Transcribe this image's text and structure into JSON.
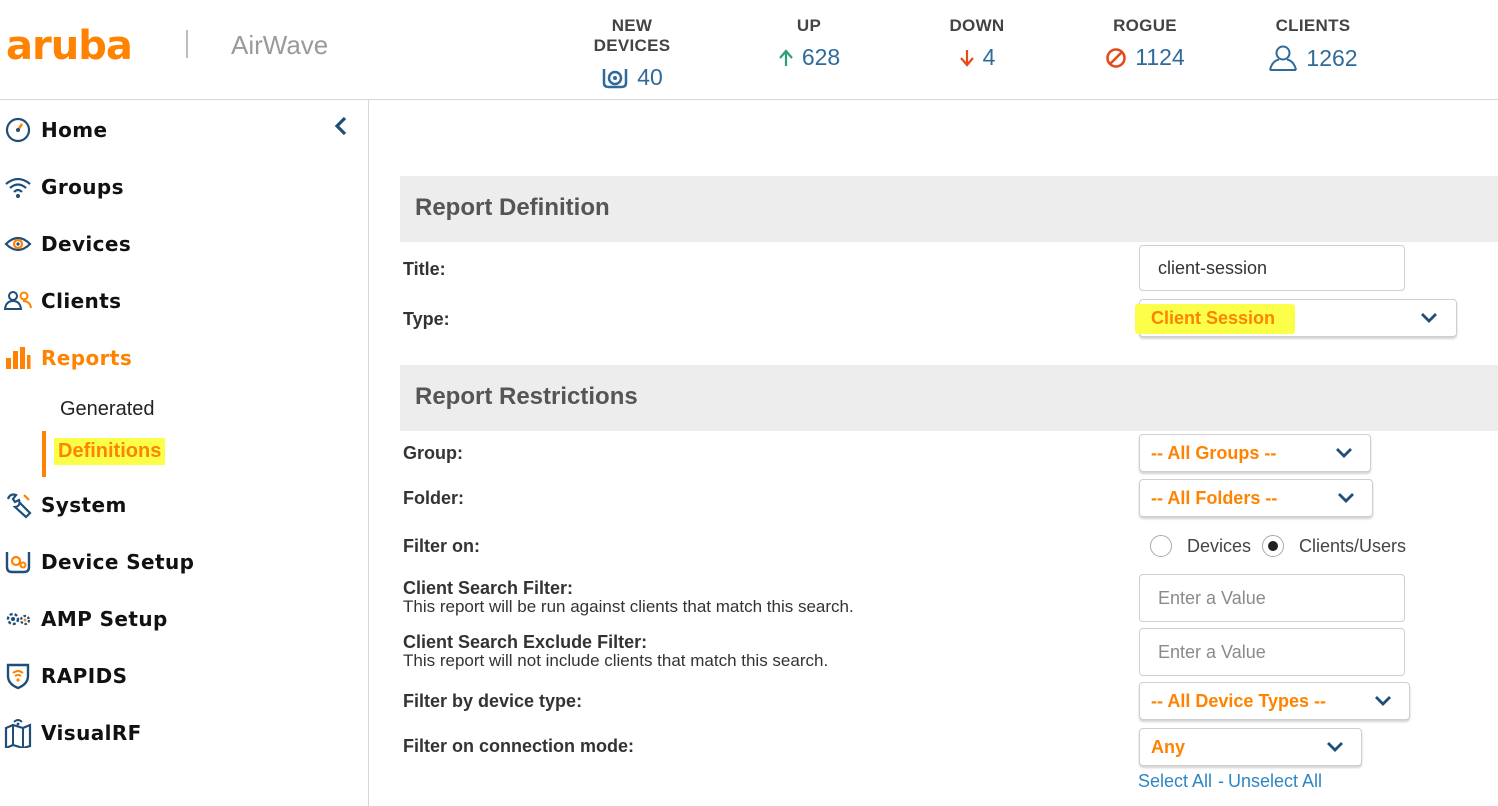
{
  "app": {
    "logo": "aruba",
    "product": "AirWave"
  },
  "stats": [
    {
      "label": "NEW DEVICES",
      "value": "40",
      "icon": "new-devices-icon"
    },
    {
      "label": "UP",
      "value": "628",
      "icon": "arrow-up-icon"
    },
    {
      "label": "DOWN",
      "value": "4",
      "icon": "arrow-down-icon"
    },
    {
      "label": "ROGUE",
      "value": "1124",
      "icon": "prohibited-icon"
    },
    {
      "label": "CLIENTS",
      "value": "1262",
      "icon": "user-icon"
    }
  ],
  "sidebar": {
    "items": [
      {
        "label": "Home",
        "icon": "dashboard-icon"
      },
      {
        "label": "Groups",
        "icon": "wifi-icon"
      },
      {
        "label": "Devices",
        "icon": "eye-icon"
      },
      {
        "label": "Clients",
        "icon": "users-icon"
      },
      {
        "label": "Reports",
        "icon": "bar-chart-icon"
      },
      {
        "label": "System",
        "icon": "tools-icon"
      },
      {
        "label": "Device Setup",
        "icon": "device-setup-icon"
      },
      {
        "label": "AMP Setup",
        "icon": "gears-icon"
      },
      {
        "label": "RAPIDS",
        "icon": "shield-wifi-icon"
      },
      {
        "label": "VisualRF",
        "icon": "map-icon"
      }
    ],
    "reports_sub": {
      "generated": "Generated",
      "definitions": "Definitions"
    }
  },
  "report_definition": {
    "heading": "Report Definition",
    "title_label": "Title:",
    "title_value": "client-session",
    "type_label": "Type:",
    "type_value": "Client Session"
  },
  "report_restrictions": {
    "heading": "Report Restrictions",
    "group_label": "Group:",
    "group_value": "-- All Groups --",
    "folder_label": "Folder:",
    "folder_value": "-- All Folders --",
    "filter_on_label": "Filter on:",
    "filter_on_options": [
      "Devices",
      "Clients/Users"
    ],
    "filter_on_selected": "Clients/Users",
    "client_search_label": "Client Search Filter:",
    "client_search_desc": "This report will be run against clients that match this search.",
    "client_search_placeholder": "Enter a Value",
    "client_exclude_label": "Client Search Exclude Filter:",
    "client_exclude_desc": "This report will not include clients that match this search.",
    "client_exclude_placeholder": "Enter a Value",
    "device_type_label": "Filter by device type:",
    "device_type_value": "-- All Device Types --",
    "connection_mode_label": "Filter on connection mode:",
    "connection_mode_value": "Any",
    "select_all": "Select All",
    "link_sep": " - ",
    "unselect_all": "Unselect All"
  },
  "colors": {
    "accent": "#ff8300",
    "link": "#2e86c1",
    "highlight": "#fbff4a",
    "stat_value": "#2f6b9a"
  }
}
